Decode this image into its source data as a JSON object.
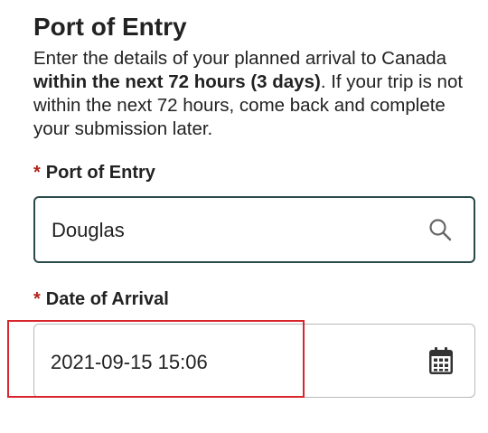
{
  "section": {
    "title": "Port of Entry",
    "intro_part1": "Enter the details of your planned arrival to Canada ",
    "intro_bold": "within the next 72 hours (3 days)",
    "intro_part2": ". If your trip is not within the next 72 hours, come back and complete your submission later."
  },
  "fields": {
    "required_mark": "*",
    "port_of_entry": {
      "label": "Port of Entry",
      "value": "Douglas",
      "icon": "search-icon"
    },
    "date_of_arrival": {
      "label": "Date of Arrival",
      "value": "2021-09-15 15:06",
      "icon": "calendar-icon"
    }
  },
  "colors": {
    "required": "#b3221c",
    "focused_border": "#2a4a4a",
    "highlight": "#d9262c"
  }
}
